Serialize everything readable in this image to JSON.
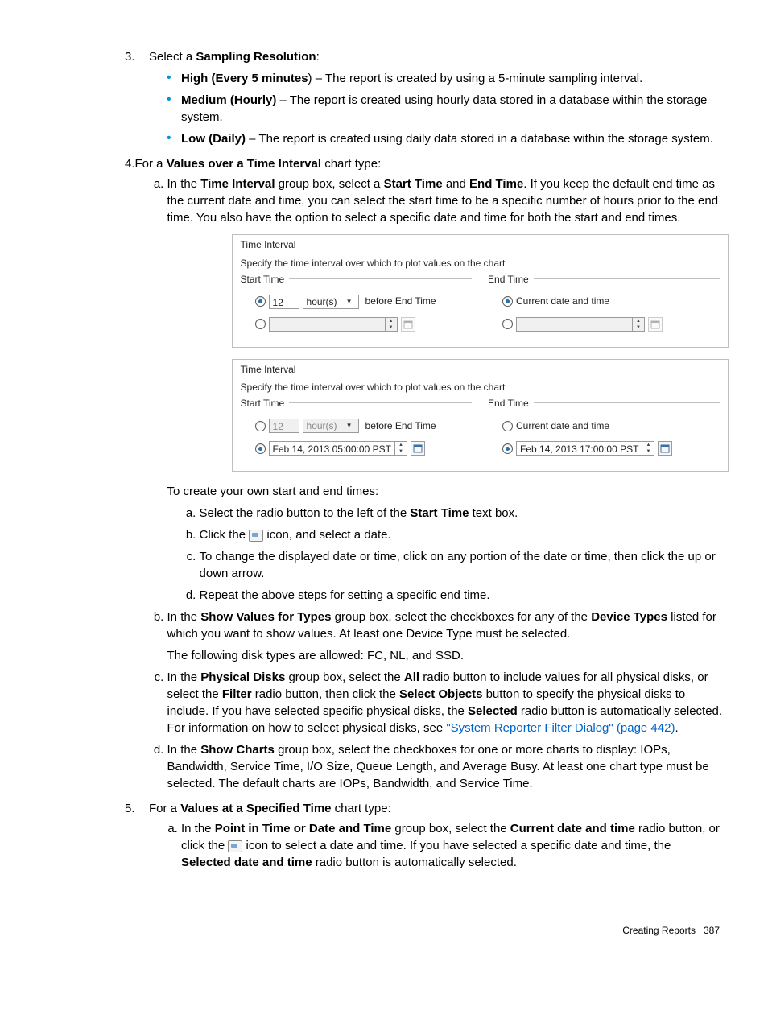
{
  "s3": {
    "num": "3.",
    "intro_a": "Select a ",
    "intro_b": "Sampling Resolution",
    "intro_c": ":",
    "hi_b": "High (Every 5 minutes",
    "hi_t": ") – The report is created by using a 5-minute sampling interval.",
    "med_b": "Medium (Hourly)",
    "med_t": " – The report is created using hourly data stored in a database within the storage system.",
    "low_b": "Low (Daily)",
    "low_t": " – The report is created using daily data stored in a database within the storage system."
  },
  "s4": {
    "num": "4.",
    "intro_a": "For a ",
    "intro_b": "Values over a Time Interval",
    "intro_c": " chart type:",
    "a_1": "In the ",
    "a_2": "Time Interval",
    "a_3": " group box, select a ",
    "a_4": "Start Time",
    "a_5": " and ",
    "a_6": "End Time",
    "a_7": ". If you keep the default end time as the current date and time, you can select the start time to be a specific number of hours prior to the end time. You also have the option to select a specific date and time for both the start and end times.",
    "own": "To create your own start and end times:",
    "sub_a1": "Select the radio button to the left of the ",
    "sub_a2": "Start Time",
    "sub_a3": " text box.",
    "sub_b1": "Click the ",
    "sub_b2": " icon, and select a date.",
    "sub_c": "To change the displayed date or time, click on any portion of the date or time, then click the up or down arrow.",
    "sub_d": "Repeat the above steps for setting a specific end time.",
    "b_1": "In the ",
    "b_2": "Show Values for Types",
    "b_3": " group box, select the checkboxes for any of the ",
    "b_4": "Device Types",
    "b_5": " listed for which you want to show values. At least one Device Type must be selected.",
    "b_6": "The following disk types are allowed: FC, NL, and SSD.",
    "c_1": "In the ",
    "c_2": "Physical Disks",
    "c_3": " group box, select the ",
    "c_4": "All",
    "c_5": " radio button to include values for all physical disks, or select the ",
    "c_6": "Filter",
    "c_7": " radio button, then click the ",
    "c_8": "Select Objects ",
    "c_9": " button to specify the physical disks to include. If you have selected specific physical disks, the ",
    "c_10": "Selected",
    "c_11": " radio button is automatically selected. For information on how to select physical disks, see ",
    "c_link": "\"System Reporter Filter Dialog\" (page 442)",
    "c_12": ".",
    "d_1": "In the ",
    "d_2": "Show Charts",
    "d_3": " group box, select the checkboxes for one or more charts to display: IOPs, Bandwidth, Service Time, I/O Size, Queue Length, and Average Busy. At least one chart type must be selected. The default charts are IOPs, Bandwidth, and Service Time."
  },
  "s5": {
    "num": "5.",
    "intro_a": "For a ",
    "intro_b": "Values at a Specified Time",
    "intro_c": " chart type:",
    "a_1": "In the ",
    "a_2": "Point in Time or Date and Time",
    "a_3": " group box, select the ",
    "a_4": "Current date and time",
    "a_5": " radio button, or click the ",
    "a_6": " icon to select a date and time. If you have selected a specific date and time, the ",
    "a_7": "Selected date and time",
    "a_8": " radio button is automatically selected."
  },
  "fig": {
    "panel_title": "Time Interval",
    "desc": "Specify the time interval over which to plot values on the chart",
    "start_legend": "Start Time",
    "end_legend": "End Time",
    "hours_val": "12",
    "unit": "hour(s)",
    "before": "before End Time",
    "current": "Current date and time",
    "start_dt": "Feb 14, 2013 05:00:00 PST",
    "end_dt": "Feb 14, 2013 17:00:00 PST"
  },
  "footer": {
    "section": "Creating Reports",
    "page": "387"
  }
}
